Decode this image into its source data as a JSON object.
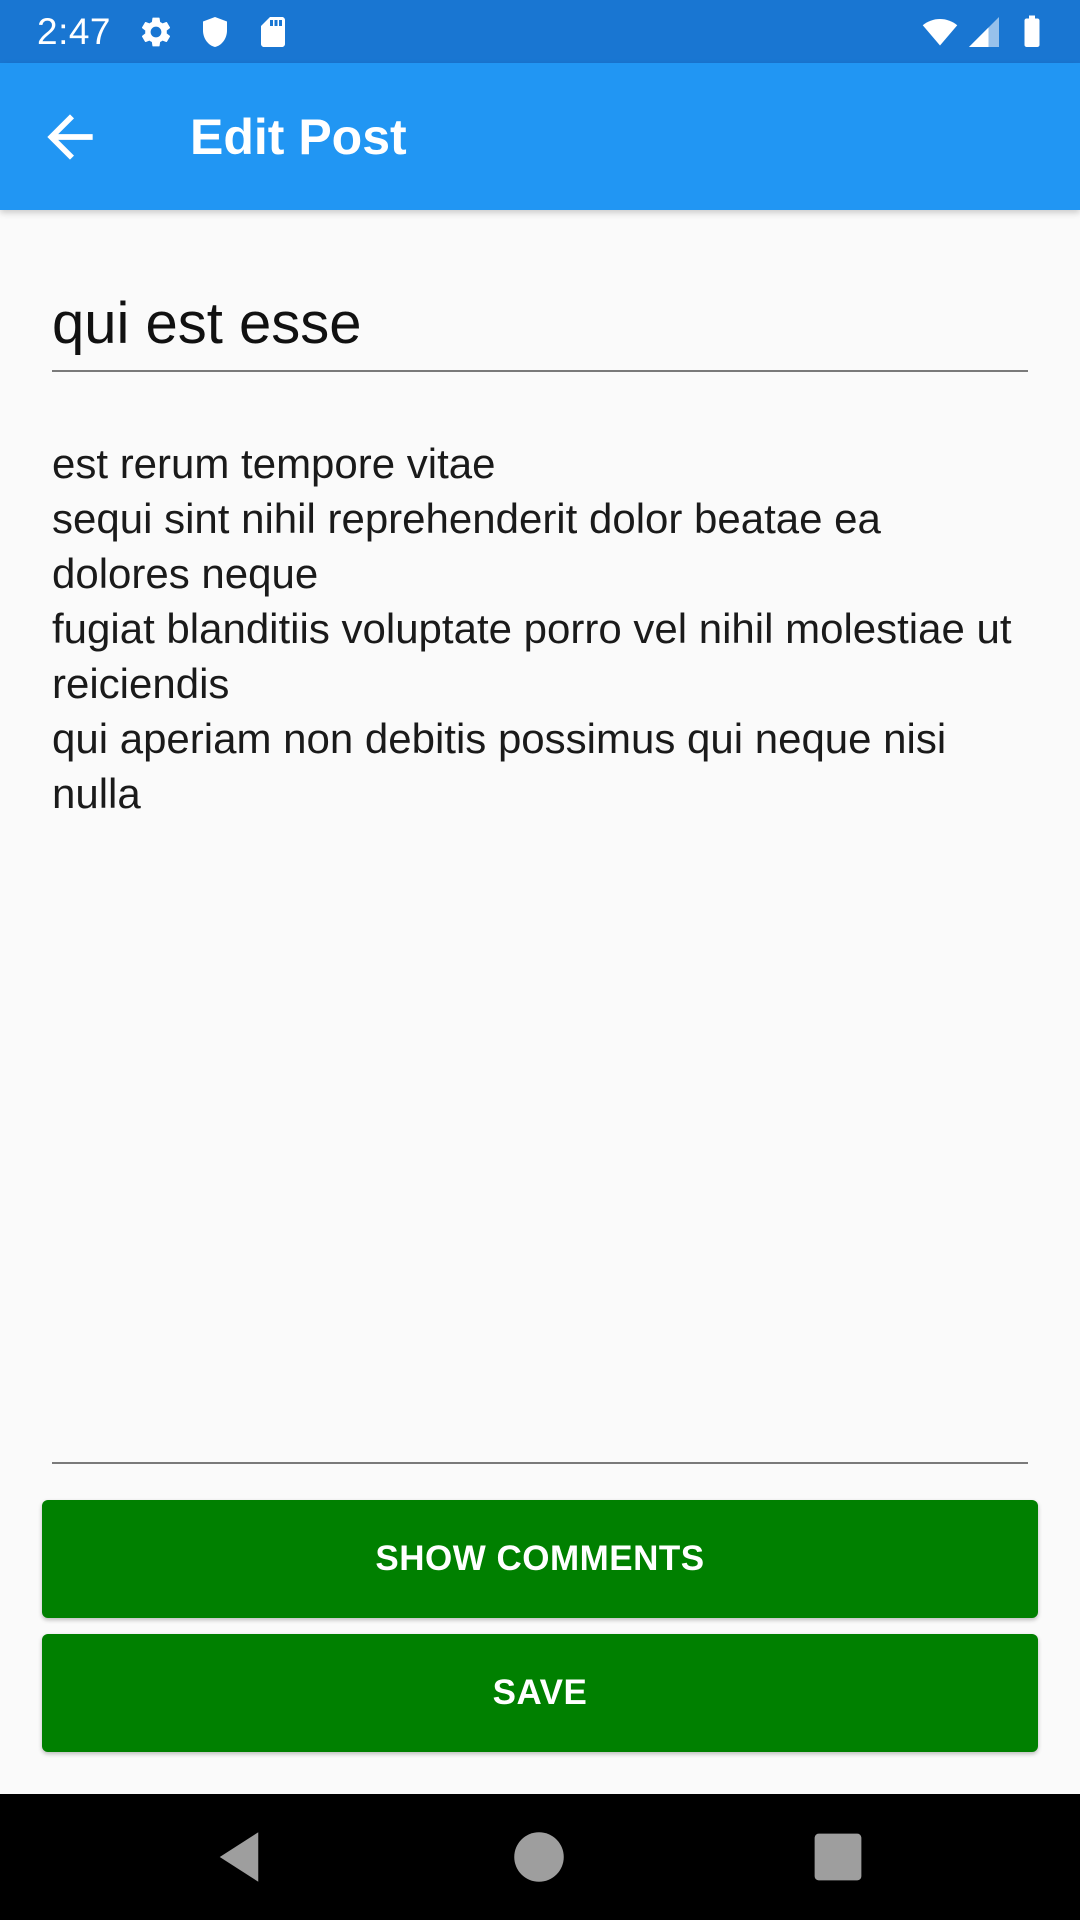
{
  "status_bar": {
    "time": "2:47",
    "background": "#1976D2",
    "icons_left": [
      "settings-icon",
      "shield-icon",
      "sd-card-icon"
    ],
    "icons_right": [
      "wifi-icon",
      "cell-signal-icon",
      "battery-icon"
    ]
  },
  "app_bar": {
    "title": "Edit Post",
    "background": "#2196F3",
    "back_icon": "arrow-back-icon"
  },
  "form": {
    "title_value": "qui est esse",
    "body_value": "est rerum tempore vitae\nsequi sint nihil reprehenderit dolor beatae ea dolores neque\nfugiat blanditiis voluptate porro vel nihil molestiae ut reiciendis\nqui aperiam non debitis possimus qui neque nisi nulla"
  },
  "buttons": {
    "show_comments": "SHOW COMMENTS",
    "save": "SAVE",
    "color": "#008000"
  },
  "nav_bar": {
    "items": [
      "back-icon",
      "home-icon",
      "recents-icon"
    ]
  }
}
